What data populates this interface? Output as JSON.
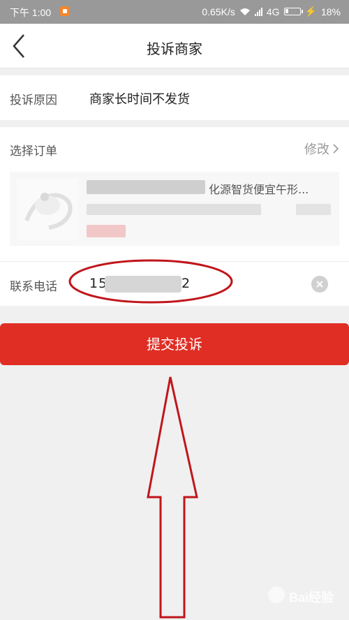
{
  "status_bar": {
    "time": "下午 1:00",
    "network_speed": "0.65K/s",
    "network_type": "4G",
    "battery": "18%"
  },
  "nav": {
    "title": "投诉商家",
    "back_icon": "chevron-left-icon"
  },
  "complaint": {
    "reason_label": "投诉原因",
    "reason_value": "商家长时间不发货",
    "order_label": "选择订单",
    "modify_label": "修改",
    "order_title": "化源智货便宜午形...",
    "phone_label": "联系电话",
    "phone_prefix": "15",
    "phone_suffix": "2"
  },
  "actions": {
    "submit_label": "提交投诉"
  },
  "colors": {
    "accent": "#e02e24",
    "annotation": "#c0161b",
    "status_bar": "#999999"
  },
  "watermark": "Bai经验"
}
